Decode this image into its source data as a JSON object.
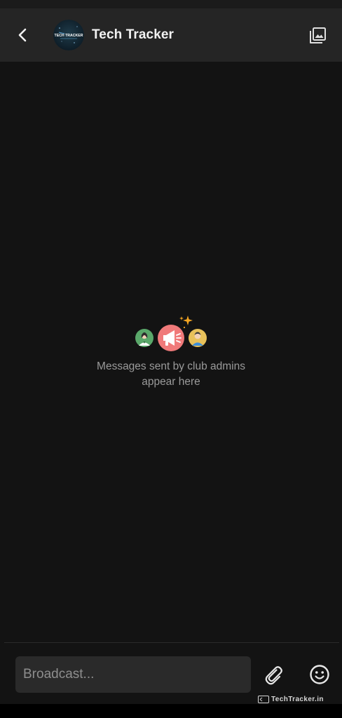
{
  "header": {
    "title": "Tech Tracker",
    "avatar_text": "TECH TRACKER",
    "back_icon": "chevron-left-icon",
    "media_icon": "photo-library-icon"
  },
  "empty_state": {
    "illustration": "club-admins-broadcast-illustration",
    "message": "Messages sent by club admins appear here"
  },
  "composer": {
    "placeholder": "Broadcast...",
    "value": "",
    "attach_icon": "paperclip-icon",
    "emoji_icon": "smiley-icon"
  },
  "watermark": {
    "text": "TechTracker.in"
  },
  "colors": {
    "background": "#131313",
    "header": "#252525",
    "input": "#2a2a2a",
    "text_primary": "#f2f2f2",
    "text_muted": "#9a9a9a",
    "megaphone_accent": "#f07a7a"
  }
}
